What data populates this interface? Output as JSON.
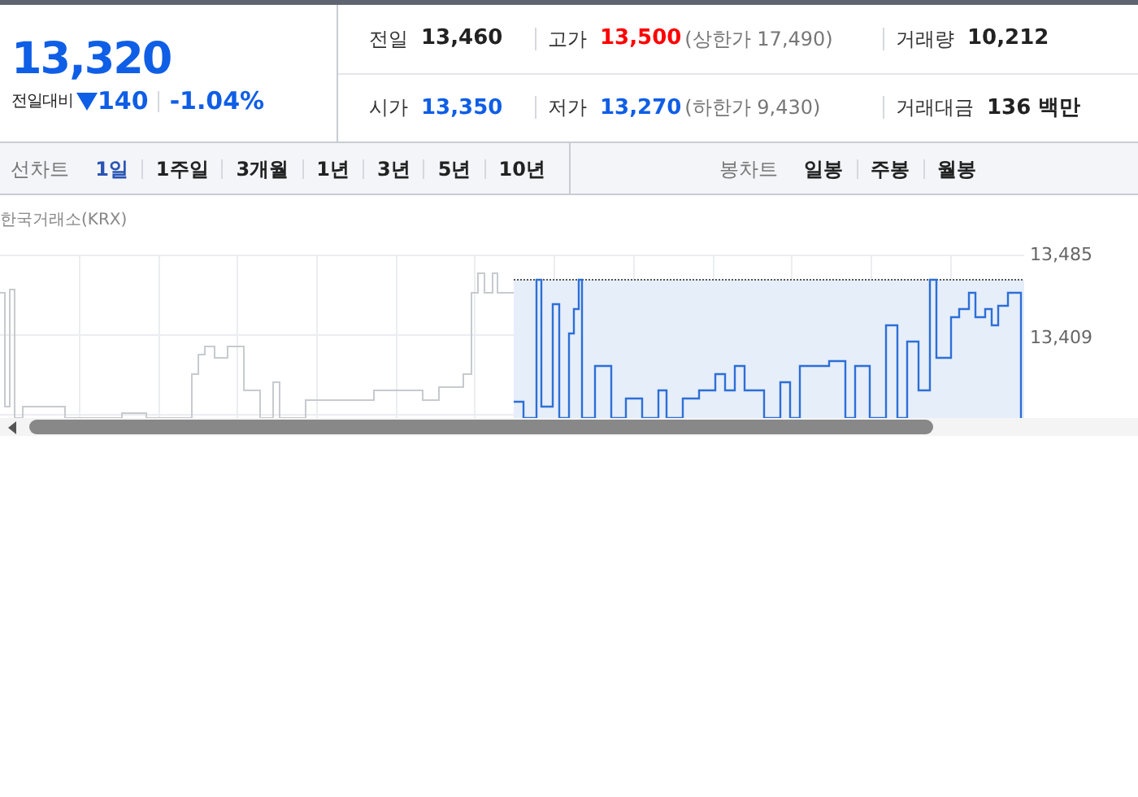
{
  "quote": {
    "price": "13,320",
    "change_label": "전일대비",
    "falling": true,
    "color": "#0f5ee6",
    "change_value": "140",
    "change_percent": "-1.04%"
  },
  "stats": [
    [
      {
        "label": "전일",
        "value": "13,460",
        "color": "#222222"
      },
      {
        "label": "고가",
        "value": "13,500",
        "color": "#ff0000",
        "note": "(상한가 17,490)"
      },
      {
        "label": "거래량",
        "value": "10,212",
        "color": "#222222"
      }
    ],
    [
      {
        "label": "시가",
        "value": "13,350",
        "color": "#0f5ee6"
      },
      {
        "label": "저가",
        "value": "13,270",
        "color": "#0f5ee6",
        "note": "(하한가 9,430)"
      },
      {
        "label": "거래대금",
        "value": "136 백만",
        "color": "#222222"
      }
    ]
  ],
  "toolbar": [
    {
      "label": "선차트",
      "options": [
        {
          "label": "1일",
          "selected": true
        },
        {
          "label": "1주일",
          "selected": false
        },
        {
          "label": "3개월",
          "selected": false
        },
        {
          "label": "1년",
          "selected": false
        },
        {
          "label": "3년",
          "selected": false
        },
        {
          "label": "5년",
          "selected": false
        },
        {
          "label": "10년",
          "selected": false
        }
      ]
    },
    {
      "label": "봉차트",
      "options": [
        {
          "label": "일봉",
          "selected": false
        },
        {
          "label": "주봉",
          "selected": false
        },
        {
          "label": "월봉",
          "selected": false
        }
      ]
    }
  ],
  "chart": {
    "source": "한국거래소(KRX)",
    "y_labels": [
      "13,485",
      "13,409"
    ]
  }
}
